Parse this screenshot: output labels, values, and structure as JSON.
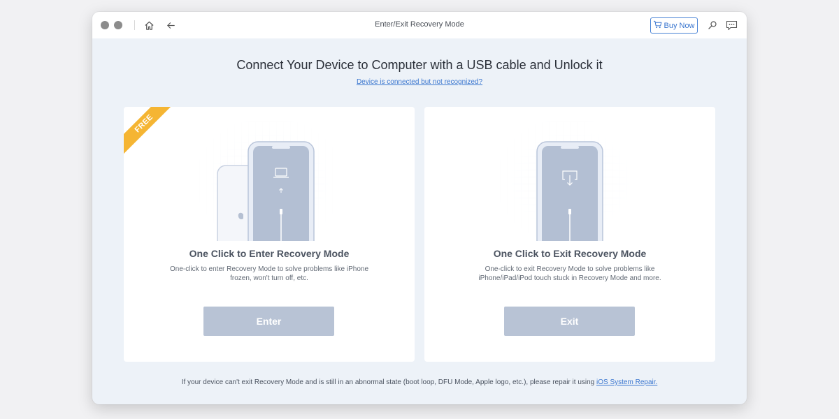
{
  "window": {
    "title": "Enter/Exit Recovery Mode",
    "buy_now_label": "Buy Now",
    "icons": [
      "home-icon",
      "back-arrow-icon",
      "cart-icon",
      "search-icon",
      "feedback-icon"
    ]
  },
  "main": {
    "headline": "Connect Your Device to Computer with a USB cable and Unlock it",
    "help_link": "Device is connected but not recognized?"
  },
  "cards": [
    {
      "badge": "FREE",
      "title": "One Click to Enter Recovery Mode",
      "description": "One-click to enter Recovery Mode to solve problems like iPhone frozen, won't turn off, etc.",
      "button_label": "Enter"
    },
    {
      "title": "One Click to Exit Recovery Mode",
      "description": "One-click to exit Recovery Mode to solve problems like iPhone/iPad/iPod touch stuck in Recovery Mode and more.",
      "button_label": "Exit"
    }
  ],
  "footer": {
    "text": "If your device can't exit Recovery Mode and is still in an abnormal state (boot loop, DFU Mode, Apple logo, etc.), please repair it using ",
    "link": "iOS System Repair."
  },
  "colors": {
    "accent": "#3a76cf",
    "badge": "#f5b533",
    "button": "#b8c3d5",
    "background": "#edf2f8"
  }
}
